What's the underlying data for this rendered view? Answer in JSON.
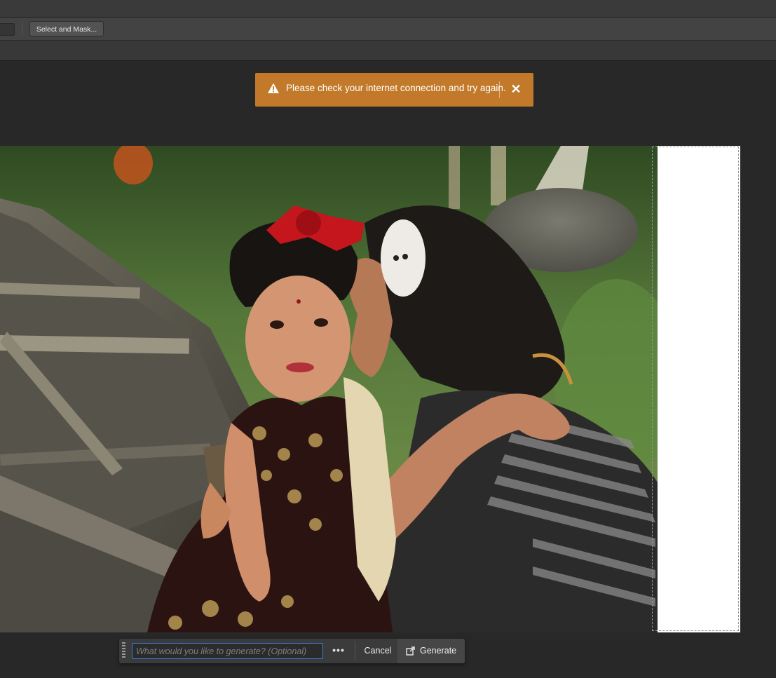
{
  "options_bar": {
    "select_and_mask_label": "Select and Mask..."
  },
  "toast": {
    "message": "Please check your internet connection and try again.",
    "icon": "warning-icon",
    "close_icon": "close-icon",
    "color": "#c27a2a"
  },
  "canvas": {
    "image_description_icon": "photo-canvas",
    "extension_color": "#ffffff"
  },
  "taskbar": {
    "prompt_placeholder": "What would you like to generate? (Optional)",
    "prompt_value": "",
    "more_label": "•••",
    "cancel_label": "Cancel",
    "generate_label": "Generate",
    "generate_icon": "generate-icon",
    "accent": "#3a7bd5"
  }
}
